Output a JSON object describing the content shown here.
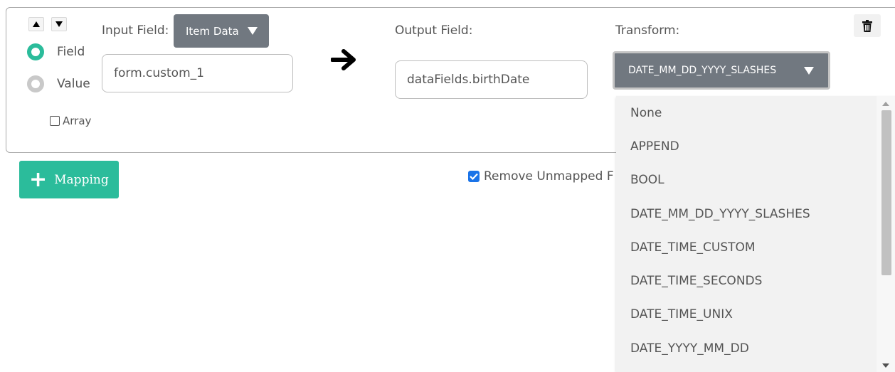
{
  "mapping": {
    "input_field_label": "Input Field:",
    "input_source": "Item Data",
    "source_options": [
      {
        "label": "Field",
        "selected": true
      },
      {
        "label": "Value",
        "selected": false
      }
    ],
    "input_value": "form.custom_1",
    "array_label": "Array",
    "array_checked": false,
    "output_field_label": "Output Field:",
    "output_value": "dataFields.birthDate",
    "transform_label": "Transform:",
    "transform_selected": "DATE_MM_DD_YYYY_SLASHES"
  },
  "transform_options": [
    "None",
    "APPEND",
    "BOOL",
    "DATE_MM_DD_YYYY_SLASHES",
    "DATE_TIME_CUSTOM",
    "DATE_TIME_SECONDS",
    "DATE_TIME_UNIX",
    "DATE_YYYY_MM_DD"
  ],
  "footer": {
    "add_mapping_label": "Mapping",
    "remove_unmapped_label": "Remove Unmapped F",
    "remove_unmapped_checked": true
  },
  "colors": {
    "accent": "#2bbc9b",
    "dropdown_button": "#717880",
    "dropdown_menu": "#f2f2f2",
    "checkbox_checked": "#1a73e8"
  }
}
